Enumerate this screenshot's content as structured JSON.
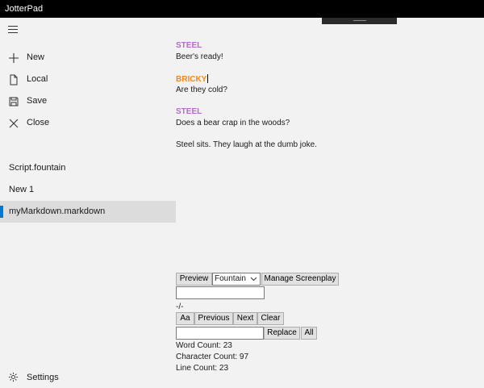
{
  "app": {
    "title": "JotterPad"
  },
  "sidebar": {
    "menu_icon": "hamburger-menu-icon",
    "actions": [
      {
        "label": "New",
        "icon": "plus-icon"
      },
      {
        "label": "Local",
        "icon": "document-icon"
      },
      {
        "label": "Save",
        "icon": "save-icon"
      },
      {
        "label": "Close",
        "icon": "close-icon"
      }
    ],
    "files": [
      {
        "label": "Script.fountain",
        "selected": false
      },
      {
        "label": "New 1",
        "selected": false
      },
      {
        "label": "myMarkdown.markdown",
        "selected": true
      }
    ],
    "settings": {
      "label": "Settings",
      "icon": "gear-icon"
    }
  },
  "editor": {
    "blocks": [
      {
        "character": "STEEL",
        "line": "Beer's ready!"
      },
      {
        "character": "BRICKY",
        "line": "Are they cold?"
      },
      {
        "character": "STEEL",
        "line": "Does a bear crap in the woods?"
      }
    ],
    "action": "Steel sits.  They laugh at the dumb joke.",
    "colors": {
      "steel": "#b36ad1",
      "bricky": "#f08a1f"
    }
  },
  "controls": {
    "preview_label": "Preview",
    "mode_selected": "Fountain",
    "manage_label": "Manage Screenplay",
    "search_value": "",
    "match_status": "-/-",
    "case_label": "Aa",
    "previous_label": "Previous",
    "next_label": "Next",
    "clear_label": "Clear",
    "replace_value": "",
    "replace_label": "Replace",
    "all_label": "All"
  },
  "stats": {
    "word_count": "Word Count: 23",
    "char_count": "Character Count: 97",
    "line_count": "Line Count: 23"
  },
  "theme": {
    "accent": "#0078d4",
    "titlebar": "#000000"
  }
}
